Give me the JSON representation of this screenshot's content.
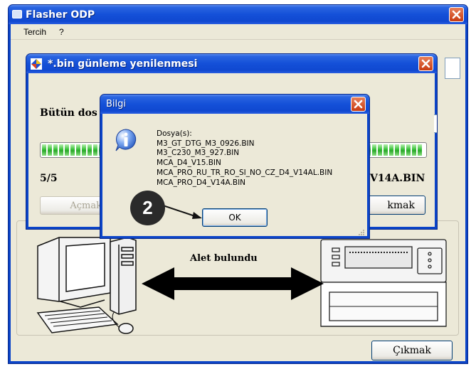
{
  "main_window": {
    "title": "Flasher ODP",
    "menu": [
      "Tercih",
      "?"
    ],
    "device_status": "Alet bulundu",
    "exit_button": "Çıkmak"
  },
  "update_window": {
    "title": "*.bin günleme yenilenmesi",
    "label": "Bütün dos",
    "count": "5/5",
    "current_file_tail": "V14A.BIN",
    "open_button": "Açmak",
    "exit_button": "kmak",
    "progress_percent": 100
  },
  "info_dialog": {
    "title": "Bilgi",
    "lines": [
      "Dosya(s):",
      "M3_GT_DTG_M3_0926.BIN",
      "M3_C230_M3_927.BIN",
      "MCA_D4_V15.BIN",
      "MCA_PRO_RU_TR_RO_SI_NO_CZ_D4_V14AL.BIN",
      "MCA_PRO_D4_V14A.BIN"
    ],
    "ok_button": "OK"
  },
  "callout_number": "2",
  "colors": {
    "titlebar": "#1450d8",
    "window_body": "#ece9d8",
    "close_button": "#c83a10",
    "progress_fill": "#2aa82a"
  },
  "icons": [
    "app-icon",
    "diamond-icon",
    "info-icon",
    "close-icon",
    "computer-icon",
    "device-icon",
    "double-arrow-icon"
  ]
}
